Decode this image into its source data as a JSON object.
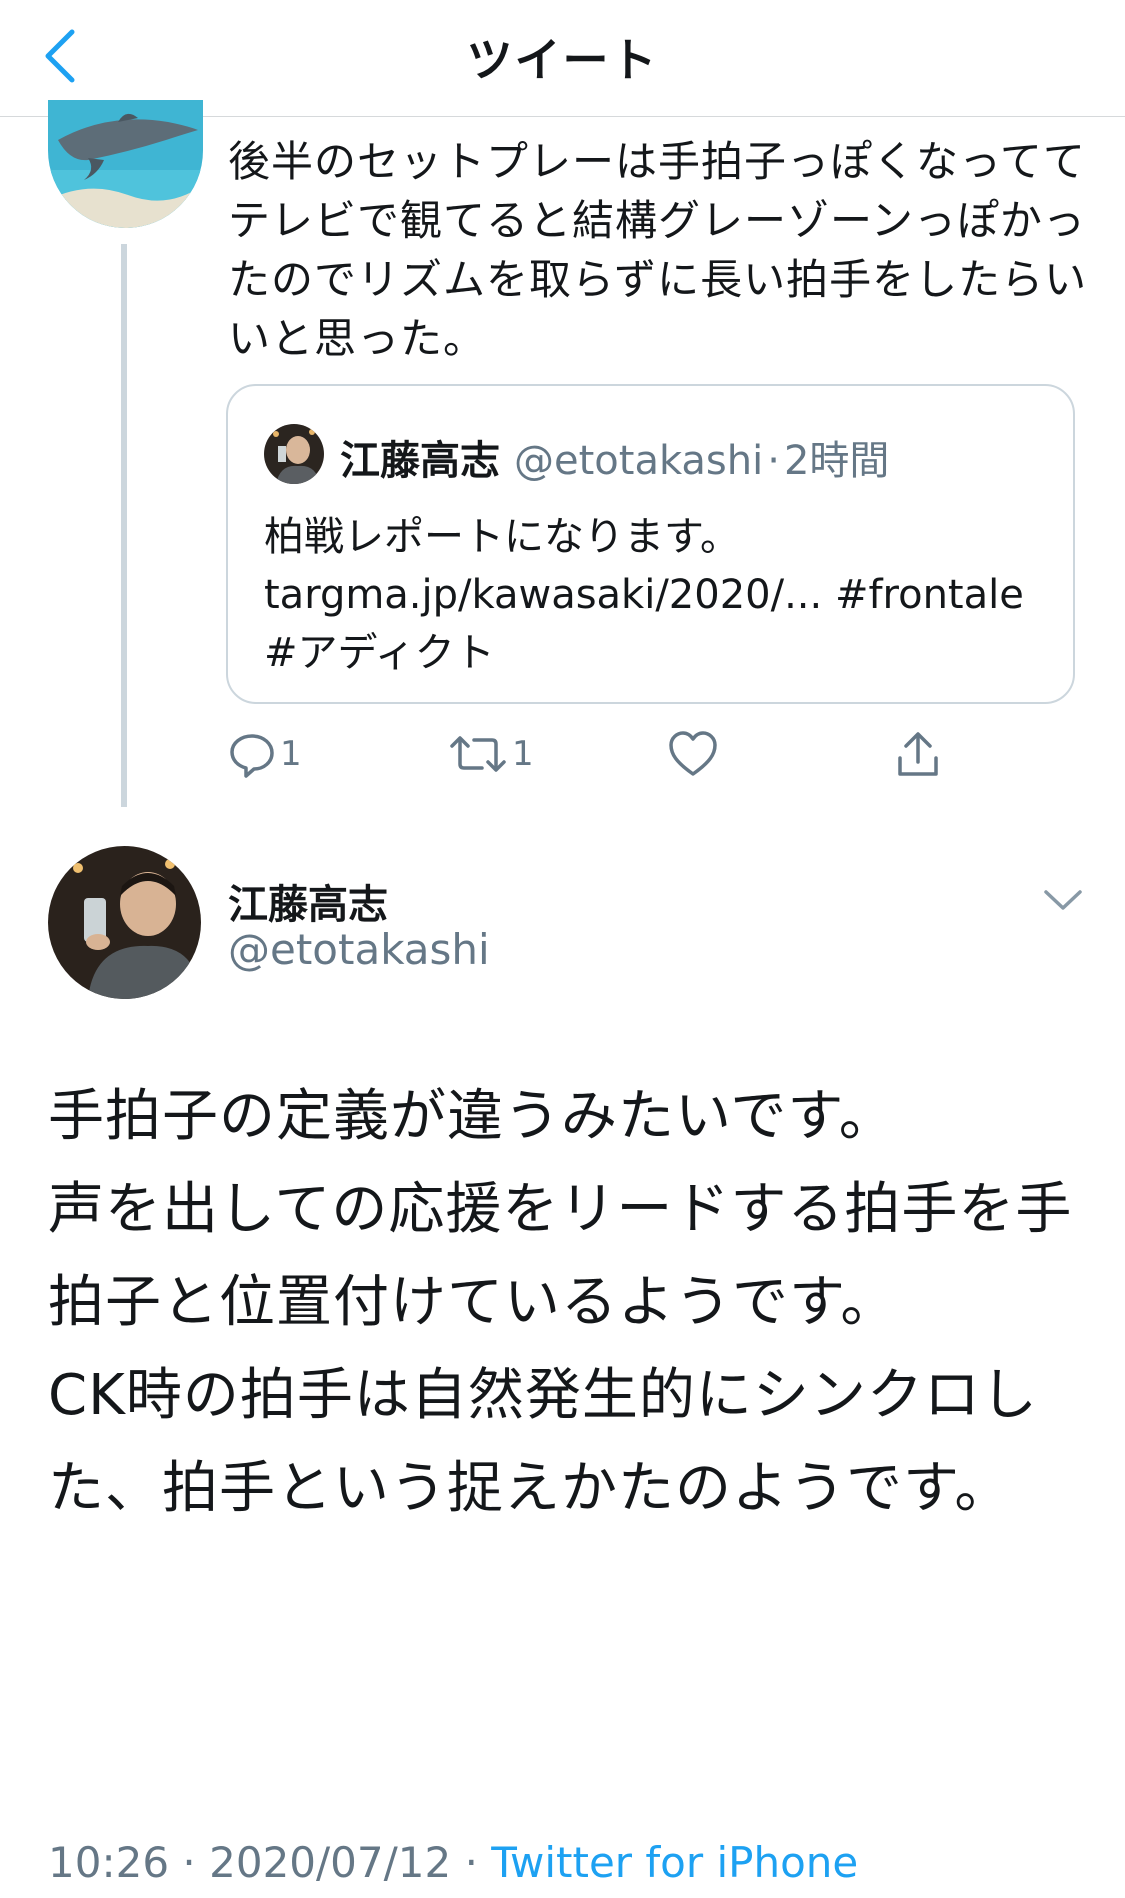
{
  "header": {
    "title": "ツイート",
    "back_icon": "chevron-left-icon"
  },
  "parent_tweet": {
    "avatar": "dolphin-avatar",
    "text": "後半のセットプレーは手拍子っぽくなっててテレビで観てると結構グレーゾーンっぽかったのでリズムを取らずに長い拍手をしたらいいと思った。",
    "quote": {
      "name": "江藤高志",
      "handle": "@etotakashi",
      "separator": "·",
      "time": "2時間",
      "line1": "柏戦レポートになります。",
      "line2": "targma.jp/kawasaki/2020/... #frontale",
      "line3": "#アディクト"
    },
    "actions": {
      "reply_count": "1",
      "retweet_count": "1"
    }
  },
  "main_tweet": {
    "name": "江藤高志",
    "handle": "@etotakashi",
    "paragraphs": [
      "手拍子の定義が違うみたいです。",
      "声を出しての応援をリードする拍手を手拍子と位置付けているようです。",
      "CK時の拍手は自然発生的にシンクロした、拍手という捉えかたのようです。"
    ],
    "time": "10:26",
    "sep": "·",
    "date": "2020/07/12",
    "source": "Twitter for iPhone"
  },
  "colors": {
    "accent": "#1da1f2",
    "secondary_text": "#657786",
    "border": "#ccd6dd"
  }
}
